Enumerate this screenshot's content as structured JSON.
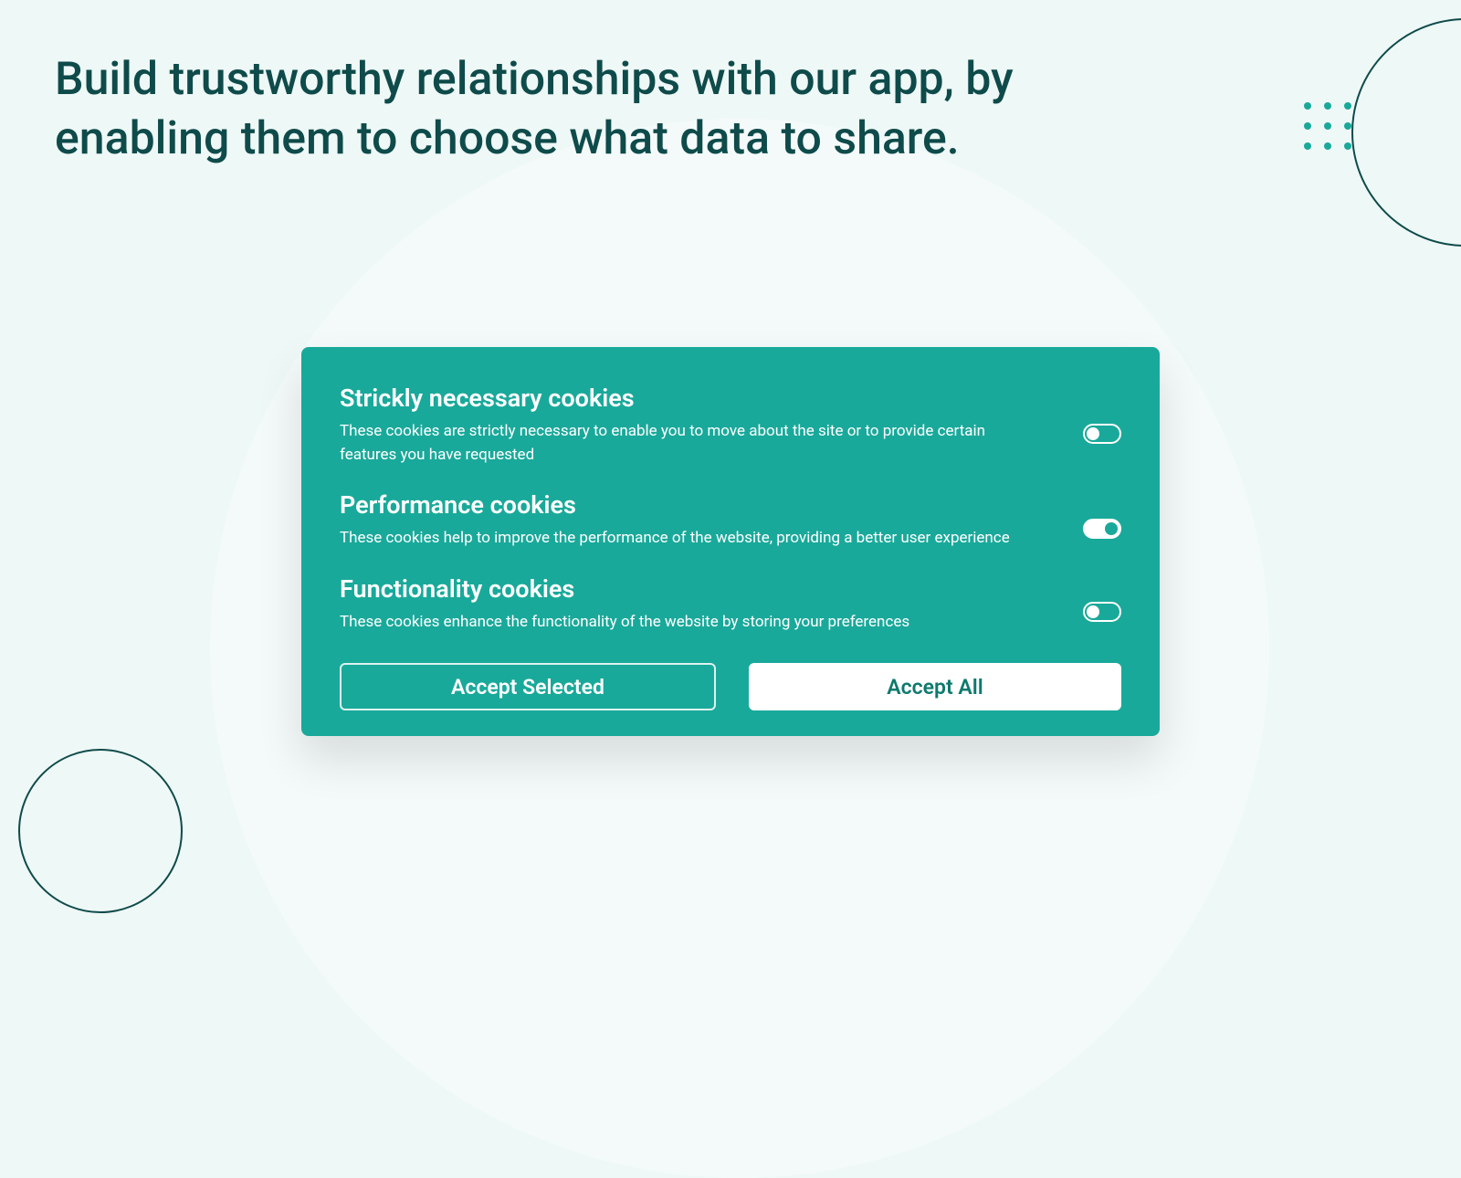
{
  "headline": "Build trustworthy relationships with our app, by enabling them to choose what data to share.",
  "cookies": {
    "items": [
      {
        "title": "Strickly necessary cookies",
        "desc": "These cookies are strictly necessary to enable you to move about the site or to provide certain features you have  requested",
        "enabled": false
      },
      {
        "title": "Performance cookies",
        "desc": "These cookies help to improve the performance of the website, providing a better user experience",
        "enabled": true
      },
      {
        "title": "Functionality cookies",
        "desc": "These cookies enhance the functionality of the website by storing your preferences",
        "enabled": false
      }
    ]
  },
  "buttons": {
    "accept_selected": "Accept Selected",
    "accept_all": "Accept All"
  },
  "colors": {
    "brand": "#19a99a",
    "brand_dark": "#0e4b4a",
    "bg": "#eef8f6"
  }
}
